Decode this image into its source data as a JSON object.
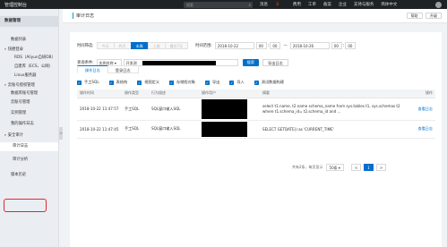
{
  "topbar": {
    "brand": "管理控制台",
    "search_placeholder": "搜索",
    "nav": {
      "messages": "消息",
      "messages_count": "3",
      "billing": "费用",
      "tickets": "工单",
      "icp": "备案",
      "enterprise": "企业",
      "support": "支持与服务",
      "language": "简体中文"
    }
  },
  "sidebar": {
    "title": "数据管理",
    "items": {
      "db_list": "数据列表",
      "quick_entry": "快捷登录",
      "rds": "RDS（Aliyun自研DB）",
      "ecs": "自建库（ECS、公网）",
      "linux_db": "Linux服务器",
      "cloud_acct": "云账号授权管理",
      "db_acct": "数据库账号管理",
      "cloud_perm": "云账号管理",
      "instance": "实例管理",
      "my_ops": "我的操作日志",
      "security": "安全审计",
      "audit_log": "审计日志",
      "audit_analysis": "审计分析",
      "version": "版本历史"
    }
  },
  "main": {
    "page_title": "审计日志",
    "head_buttons": {
      "help": "帮助",
      "upgrade": "升级"
    },
    "filters": {
      "time_label": "时间筛选:",
      "ranges": [
        "今天",
        "昨天",
        "本周",
        "上周",
        "最近7天"
      ],
      "active_range": "本周",
      "time_range_label": "时间范围:",
      "start_date": "2018-10-22",
      "start_h": "00",
      "start_m": "00",
      "to": "—",
      "end_date": "2018-10-26",
      "end_h": "00",
      "end_m": "00",
      "query_label": "查询条件:",
      "query_field": "实例名称",
      "query_value": "开发测",
      "search_btn": "搜索",
      "export_btn": "导出日志"
    },
    "tabs": [
      "操作日志",
      "登录日志"
    ],
    "checks": [
      "手工SQL",
      "表结构",
      "视图定义",
      "存储程对象",
      "导出",
      "导入",
      "测试数据构建"
    ],
    "table": {
      "headers": [
        "操作时间",
        "操作类型",
        "行为描述",
        "操作用户",
        "",
        "摘要",
        "操作"
      ],
      "rows": [
        {
          "time": "2018-10-22 11:47:57",
          "type": "手工SQL",
          "desc": "SQL窗口输入SQL",
          "summary": "select t1.name, t2.name schema_name from sys.tables t1, sys.schemas t2 where t1.schema_id= t2.schema_id and ...",
          "op": "查看日志"
        },
        {
          "time": "2018-10-22 11:47:45",
          "type": "手工SQL",
          "desc": "SQL窗口输入SQL",
          "summary": "SELECT GETDATE() as 'CURRENT_TIME'",
          "op": "查看日志"
        }
      ]
    },
    "pager": {
      "total": "共有2条，每页显示",
      "page_size": "50条",
      "prev": "<",
      "current": "1",
      "next": ">"
    }
  }
}
